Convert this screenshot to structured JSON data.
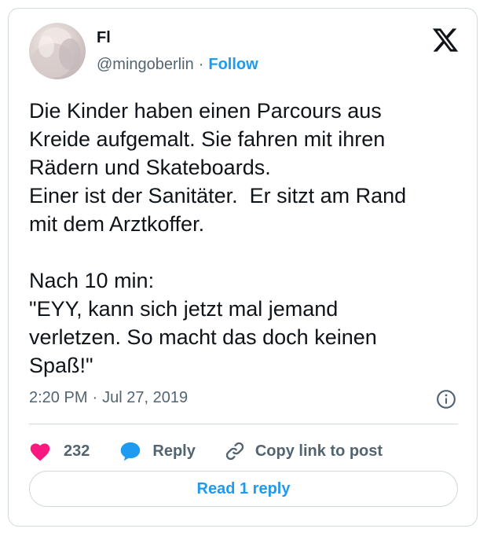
{
  "author": {
    "name": "Fl",
    "handle": "@mingoberlin",
    "separator": "·",
    "follow_label": "Follow"
  },
  "brand": {
    "logo_icon": "x-logo-icon"
  },
  "tweet": {
    "text": "Die Kinder haben einen Parcours aus\nKreide aufgemalt. Sie fahren mit ihren\nRädern und Skateboards.\nEiner ist der Sanitäter.  Er sitzt am Rand\nmit dem Arztkoffer.\n\nNach 10 min:\n\"EYY, kann sich jetzt mal jemand\nverletzen. So macht das doch keinen\nSpaß!\"",
    "time": "2:20 PM",
    "date_separator": "·",
    "date": "Jul 27, 2019",
    "info_icon": "info-icon"
  },
  "actions": {
    "like_count": "232",
    "like_icon": "heart-icon",
    "reply_label": "Reply",
    "reply_icon": "speech-bubble-icon",
    "copy_label": "Copy link to post",
    "copy_icon": "link-icon"
  },
  "read_replies": {
    "label": "Read 1 reply"
  },
  "colors": {
    "accent": "#1d9bf0",
    "like": "#f91880",
    "text_primary": "#0f1419",
    "text_secondary": "#536471",
    "border": "#cfd9de"
  }
}
